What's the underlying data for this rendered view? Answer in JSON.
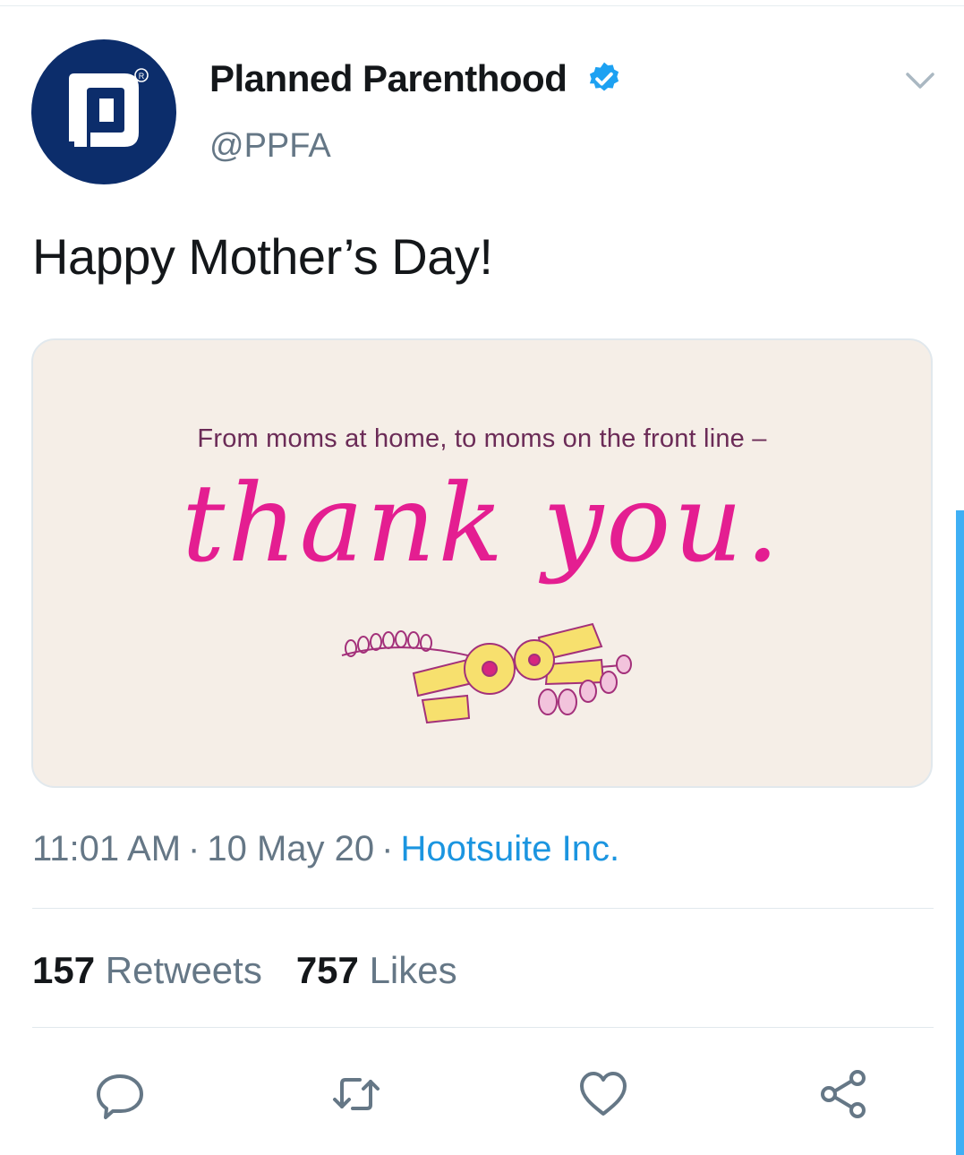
{
  "account": {
    "display_name": "Planned Parenthood",
    "handle": "@PPFA",
    "verified": true,
    "avatar_icon": "planned-parenthood-logo"
  },
  "tweet": {
    "text": "Happy Mother’s Day!"
  },
  "media": {
    "caption": "From moms at home, to moms on the front line –",
    "headline": "thank you.",
    "decoration": "flower-garland",
    "background_color": "#f5eee7",
    "headline_color": "#e41e91"
  },
  "meta": {
    "time": "11:01 AM",
    "separator": "·",
    "date": "10 May 20",
    "source": "Hootsuite Inc."
  },
  "stats": {
    "retweets_count": "157",
    "retweets_label": "Retweets",
    "likes_count": "757",
    "likes_label": "Likes"
  },
  "actions": [
    {
      "icon": "reply-icon"
    },
    {
      "icon": "retweet-icon"
    },
    {
      "icon": "like-icon"
    },
    {
      "icon": "share-icon"
    }
  ],
  "colors": {
    "accent": "#1b95e0",
    "avatar_bg": "#0c2d6b",
    "secondary_text": "#657786"
  }
}
